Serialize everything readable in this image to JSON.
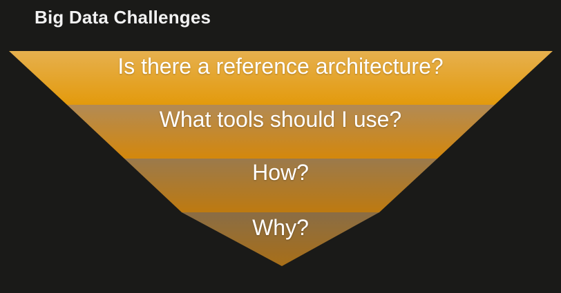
{
  "slide": {
    "title": "Big Data Challenges"
  },
  "funnel": {
    "levels": [
      {
        "label": "Is there a reference architecture?"
      },
      {
        "label": "What tools should I use?"
      },
      {
        "label": "How?"
      },
      {
        "label": "Why?"
      }
    ]
  },
  "colors": {
    "background": "#1a1a18",
    "title_text": "#f2f2f2",
    "label_text": "#ffffff",
    "level_1_top": "#e6b04e",
    "level_1_bottom": "#e39a0c",
    "level_2_top": "#b28a55",
    "level_2_bottom": "#d4880c",
    "level_3_top": "#9b7a4c",
    "level_3_bottom": "#be7a10",
    "level_4_top": "#8a6d45",
    "level_4_bottom": "#a86f18"
  }
}
